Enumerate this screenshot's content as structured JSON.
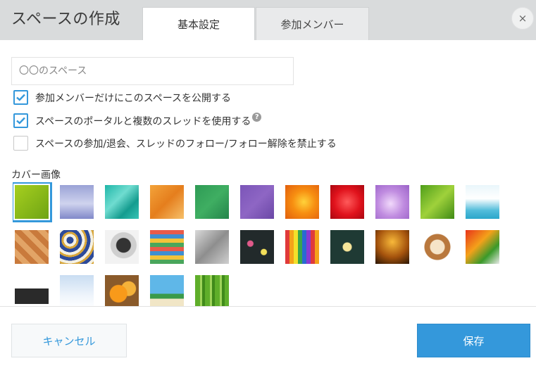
{
  "dialog": {
    "title": "スペースの作成",
    "close_icon": "close-icon",
    "close_glyph": "×"
  },
  "tabs": [
    {
      "label": "基本設定",
      "active": true
    },
    {
      "label": "参加メンバー",
      "active": false
    }
  ],
  "name_input": {
    "placeholder": "〇〇のスペース",
    "value": ""
  },
  "options": [
    {
      "label": "参加メンバーだけにこのスペースを公開する",
      "checked": true
    },
    {
      "label": "スペースのポータルと複数のスレッドを使用する",
      "checked": true,
      "help": "?"
    },
    {
      "label": "スペースの参加/退会、スレッドのフォロー/フォロー解除を禁止する",
      "checked": false
    }
  ],
  "cover": {
    "label": "カバー画像",
    "selected_index": 0,
    "thumbnails": [
      {
        "id": "lime-green"
      },
      {
        "id": "lavender-gradient"
      },
      {
        "id": "teal-water"
      },
      {
        "id": "orange-paper"
      },
      {
        "id": "green-texture"
      },
      {
        "id": "purple-texture"
      },
      {
        "id": "orange-flower"
      },
      {
        "id": "red-flower"
      },
      {
        "id": "lilac-flower"
      },
      {
        "id": "green-leaf"
      },
      {
        "id": "white-cubes"
      },
      {
        "id": "woven-wood"
      },
      {
        "id": "mosaic-tiles"
      },
      {
        "id": "compass"
      },
      {
        "id": "book-stack"
      },
      {
        "id": "office-supplies"
      },
      {
        "id": "chalk-doodles"
      },
      {
        "id": "color-pencils"
      },
      {
        "id": "lightbulb-chalk"
      },
      {
        "id": "amber-glow"
      },
      {
        "id": "latte-art"
      },
      {
        "id": "vegetables"
      },
      {
        "id": "cat"
      },
      {
        "id": "snowy-trees"
      },
      {
        "id": "orange-basket"
      },
      {
        "id": "palm-beach"
      },
      {
        "id": "bamboo"
      }
    ]
  },
  "colors": {
    "accent": "#3498db",
    "header_bg": "#d9dbdc"
  },
  "footer": {
    "cancel_label": "キャンセル",
    "save_label": "保存"
  }
}
